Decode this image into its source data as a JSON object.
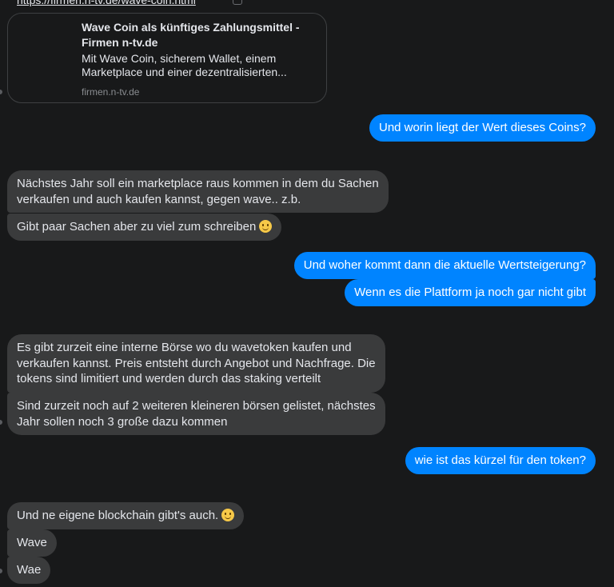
{
  "link_preview": {
    "url_text": "https://firmen.n-tv.de/wave-coin.html",
    "title": "Wave Coin als künftiges Zahlungsmittel - Firmen n-tv.de",
    "description": "Mit Wave Coin, sicherem Wallet, einem Marketplace und einer dezentralisierten...",
    "domain": "firmen.n-tv.de"
  },
  "messages": [
    {
      "direction": "outgoing",
      "text": "Und worin liegt der Wert dieses Coins?"
    },
    {
      "direction": "incoming",
      "line1": "Nächstes Jahr soll ein marketplace raus kommen in dem du Sachen",
      "line2": "verkaufen  und auch kaufen kannst, gegen wave.. z.b."
    },
    {
      "direction": "incoming",
      "text": "Gibt paar Sachen aber zu viel zum schreiben",
      "emoji": "slightly-smiling-face"
    },
    {
      "direction": "outgoing",
      "text": "Und woher kommt dann die aktuelle Wertsteigerung?"
    },
    {
      "direction": "outgoing",
      "text": "Wenn es die Plattform ja noch gar nicht gibt"
    },
    {
      "direction": "incoming",
      "line1": "Es gibt zurzeit eine interne Börse wo du wavetoken kaufen und",
      "line2": "verkaufen kannst. Preis entsteht durch Angebot und Nachfrage. Die",
      "line3": "tokens sind limitiert und werden durch das staking verteilt"
    },
    {
      "direction": "incoming",
      "line1": "Sind zurzeit noch auf 2 weiteren kleineren börsen gelistet, nächstes",
      "line2": "Jahr sollen noch 3 große dazu kommen"
    },
    {
      "direction": "outgoing",
      "text": "wie ist das kürzel für den token?"
    },
    {
      "direction": "incoming",
      "text": "Und ne eigene blockchain gibt's auch.",
      "emoji": "slightly-smiling-face"
    },
    {
      "direction": "incoming",
      "text": "Wave"
    },
    {
      "direction": "incoming",
      "text": "Wae"
    }
  ],
  "colors": {
    "background": "#18191a",
    "incoming_bubble": "#3a3b3c",
    "outgoing_bubble": "#0084ff",
    "text": "#e4e6eb"
  }
}
